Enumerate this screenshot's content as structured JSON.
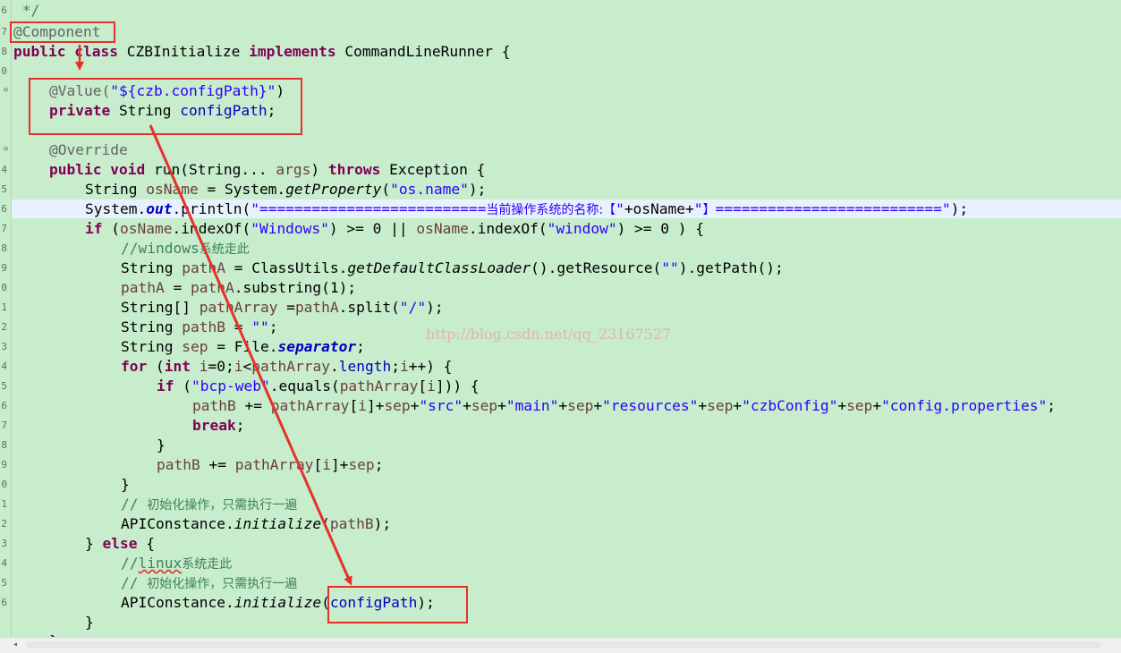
{
  "colors": {
    "background": "#c7edcc",
    "keyword": "#7f0055",
    "string": "#2a00ff",
    "field": "#0000c0",
    "annotation": "#646464",
    "comment": "#3f7f5f",
    "highlight_box": "#e5312b"
  },
  "gutter": {
    "numbers": [
      "6",
      "7",
      "8",
      "0",
      "",
      "",
      "",
      "",
      "4",
      "5",
      "6",
      "7",
      "8",
      "9",
      "0",
      "1",
      "2",
      "3",
      "4",
      "5",
      "6",
      "7",
      "8",
      "9",
      "0",
      "1",
      "2",
      "3",
      "4",
      "5",
      "6"
    ]
  },
  "code": {
    "l0_comment": " */",
    "l1_annotation": "@Component",
    "l2_kw1": "public",
    "l2_kw2": "class",
    "l2_name": " CZBInitialize ",
    "l2_kw3": "implements",
    "l2_rest": " CommandLineRunner {",
    "l3_ann": "@Value(",
    "l3_str": "\"${czb.configPath}\"",
    "l3_close": ")",
    "l4_kw": "private",
    "l4_type": " String ",
    "l4_field": "configPath",
    "l4_semi": ";",
    "l5_ann": "@Override",
    "l6_kw1": "public",
    "l6_kw2": "void",
    "l6_mid": " run(String... ",
    "l6_arg": "args",
    "l6_mid2": ") ",
    "l6_kw3": "throws",
    "l6_end": " Exception {",
    "l7_a": "String ",
    "l7_var": "osName",
    "l7_b": " = System.",
    "l7_m": "getProperty",
    "l7_c": "(",
    "l7_str": "\"os.name\"",
    "l7_d": ");",
    "l8_a": "System.",
    "l8_out": "out",
    "l8_b": ".println(",
    "l8_str1": "\"==========================",
    "l8_cjk1": "当前操作系统的名称:【",
    "l8_str2": "\"",
    "l8_plus": "+osName+",
    "l8_str3": "\"",
    "l8_cjk2": "】",
    "l8_str4": "==========================\"",
    "l8_c": ");",
    "l9_kw": "if",
    "l9_a": " (",
    "l9_var1": "osName",
    "l9_b": ".indexOf(",
    "l9_str1": "\"Windows\"",
    "l9_c": ") >= 0 || ",
    "l9_var2": "osName",
    "l9_d": ".indexOf(",
    "l9_str2": "\"window\"",
    "l9_e": ") >= 0 ) {",
    "l10_cmt": "//windows",
    "l10_cjk": "系统走此",
    "l11_a": "String ",
    "l11_var": "pathA",
    "l11_b": " = ClassUtils.",
    "l11_m": "getDefaultClassLoader",
    "l11_c": "().getResource(",
    "l11_str": "\"\"",
    "l11_d": ").getPath();",
    "l12_var1": "pathA",
    "l12_a": " = ",
    "l12_var2": "pathA",
    "l12_b": ".substring(1);",
    "l13_a": "String[] ",
    "l13_var1": "pathArray",
    "l13_b": " =",
    "l13_var2": "pathA",
    "l13_c": ".split(",
    "l13_str": "\"/\"",
    "l13_d": ");",
    "l14_a": "String ",
    "l14_var": "pathB",
    "l14_b": " = ",
    "l14_str": "\"\"",
    "l14_c": ";",
    "l15_a": "String ",
    "l15_var": "sep",
    "l15_b": " = File.",
    "l15_f": "separator",
    "l15_c": ";",
    "l16_kw1": "for",
    "l16_a": " (",
    "l16_kw2": "int",
    "l16_b": " ",
    "l16_var1": "i",
    "l16_c": "=0;",
    "l16_var2": "i",
    "l16_d": "<",
    "l16_var3": "pathArray",
    "l16_e": ".",
    "l16_len": "length",
    "l16_f": ";",
    "l16_var4": "i",
    "l16_g": "++) {",
    "l17_kw": "if",
    "l17_a": " (",
    "l17_str": "\"bcp-web\"",
    "l17_b": ".equals(",
    "l17_var1": "pathArray",
    "l17_c": "[",
    "l17_var2": "i",
    "l17_d": "])) {",
    "l18_var1": "pathB",
    "l18_a": " += ",
    "l18_var2": "pathArray",
    "l18_b": "[",
    "l18_var3": "i",
    "l18_c": "]+",
    "l18_var4": "sep",
    "l18_d": "+",
    "l18_s1": "\"src\"",
    "l18_e": "+",
    "l18_var5": "sep",
    "l18_f": "+",
    "l18_s2": "\"main\"",
    "l18_g": "+",
    "l18_var6": "sep",
    "l18_h": "+",
    "l18_s3": "\"resources\"",
    "l18_i": "+",
    "l18_var7": "sep",
    "l18_j": "+",
    "l18_s4": "\"czbConfig\"",
    "l18_k": "+",
    "l18_var8": "sep",
    "l18_l": "+",
    "l18_s5": "\"config.properties\"",
    "l18_m": ";",
    "l19_kw": "break",
    "l19_a": ";",
    "l20": "}",
    "l21_var1": "pathB",
    "l21_a": " += ",
    "l21_var2": "pathArray",
    "l21_b": "[",
    "l21_var3": "i",
    "l21_c": "]+",
    "l21_var4": "sep",
    "l21_d": ";",
    "l22": "}",
    "l23_cmt": "// ",
    "l23_cjk": "初始化操作，只需执行一遍",
    "l24_a": "APIConstance.",
    "l24_m": "initialize",
    "l24_b": "(",
    "l24_var": "pathB",
    "l24_c": ");",
    "l25_a": "} ",
    "l25_kw": "else",
    "l25_b": " {",
    "l26_cmt1": "//",
    "l26_wavy": "linux",
    "l26_cjk": "系统走此",
    "l27_cmt": "// ",
    "l27_cjk": "初始化操作，只需执行一遍",
    "l28_a": "APIConstance.",
    "l28_m": "initialize",
    "l28_b": "(",
    "l28_fld": "configPath",
    "l28_c": ");",
    "l29": "}",
    "l30": "}"
  },
  "watermark": "http://blog.csdn.net/qq_23167527"
}
